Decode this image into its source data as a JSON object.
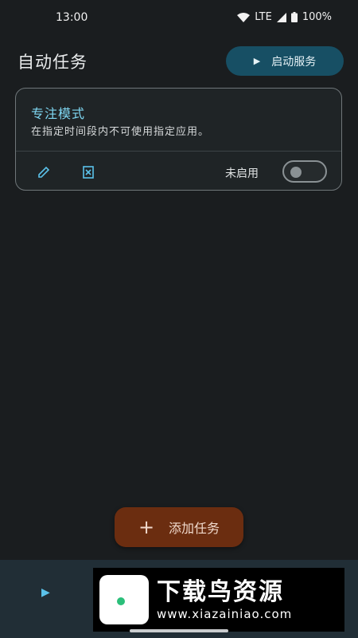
{
  "status_bar": {
    "time": "13:00",
    "network": "LTE",
    "battery": "100%",
    "icons": [
      "wifi-icon",
      "signal-icon",
      "battery-icon"
    ]
  },
  "header": {
    "title": "自动任务",
    "start_button": {
      "label": "启动服务",
      "icon": "play-icon"
    }
  },
  "tasks": [
    {
      "title": "专注模式",
      "description": "在指定时间段内不可使用指定应用。",
      "status": "未启用",
      "enabled": false,
      "actions": [
        "edit-icon",
        "delete-icon"
      ]
    }
  ],
  "fab": {
    "label": "添加任务",
    "icon": "plus-icon"
  },
  "bottom_bar": {
    "icon": "play-icon"
  },
  "watermark": {
    "brand": "下载鸟资源",
    "url": "www.xiazainiao.com"
  },
  "colors": {
    "background": "#1a1d1f",
    "accent": "#7fd7f2",
    "start_button": "#174f64",
    "fab": "#6b2d10",
    "bottom_bar": "#212e36"
  }
}
